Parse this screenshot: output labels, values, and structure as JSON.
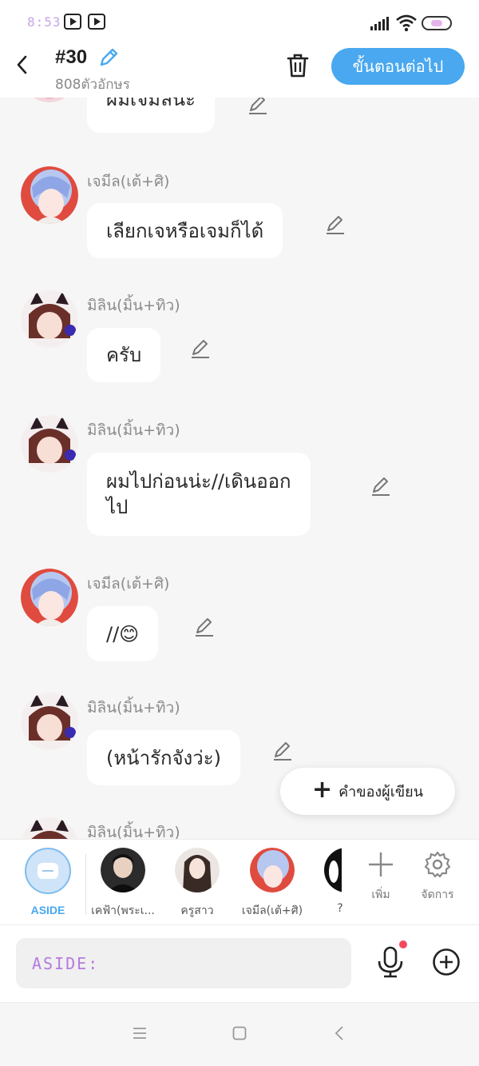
{
  "status_bar": {
    "time": "8:53"
  },
  "header": {
    "title": "#30",
    "subtitle": "808ตัวอักษร",
    "next_button": "ขั้นตอนต่อไป"
  },
  "messages": [
    {
      "name": "",
      "text": "ผมเจมีลน่ะ",
      "avatar": "jemil"
    },
    {
      "name": "เจมีล(เต้+ศิ)",
      "text": "เลียกเจหรือเจมก็ได้",
      "avatar": "jemil"
    },
    {
      "name": "มิลิน(มิ้น+ทิว)",
      "text": "ครับ",
      "avatar": "milin"
    },
    {
      "name": "มิลิน(มิ้น+ทิว)",
      "text": "ผมไปก่อนน่ะ//เดินออก\nไป",
      "avatar": "milin"
    },
    {
      "name": "เจมีล(เต้+ศิ)",
      "text": "//😊",
      "avatar": "jemil"
    },
    {
      "name": "มิลิน(มิ้น+ทิว)",
      "text": "(หน้ารักจังว่ะ)",
      "avatar": "milin"
    },
    {
      "name": "มิลิน(มิ้น+ทิว)",
      "text": "",
      "avatar": "milin"
    }
  ],
  "author_note_button": "คำของผู้เขียน",
  "characters": [
    {
      "label": "ASIDE",
      "kind": "aside"
    },
    {
      "label": "เคฟ้า(พระเ...",
      "kind": "dark"
    },
    {
      "label": "ครูสาว",
      "kind": "girl"
    },
    {
      "label": "เจมีล(เต้+ศิ)",
      "kind": "jemil"
    },
    {
      "label": "?",
      "kind": "partial"
    }
  ],
  "tools": {
    "add_label": "เพิ่ม",
    "manage_label": "จัดการ"
  },
  "input": {
    "placeholder": "ASIDE:"
  },
  "colors": {
    "accent": "#49a8ef",
    "bubble": "#ffffff",
    "background": "#f6f6f6"
  }
}
